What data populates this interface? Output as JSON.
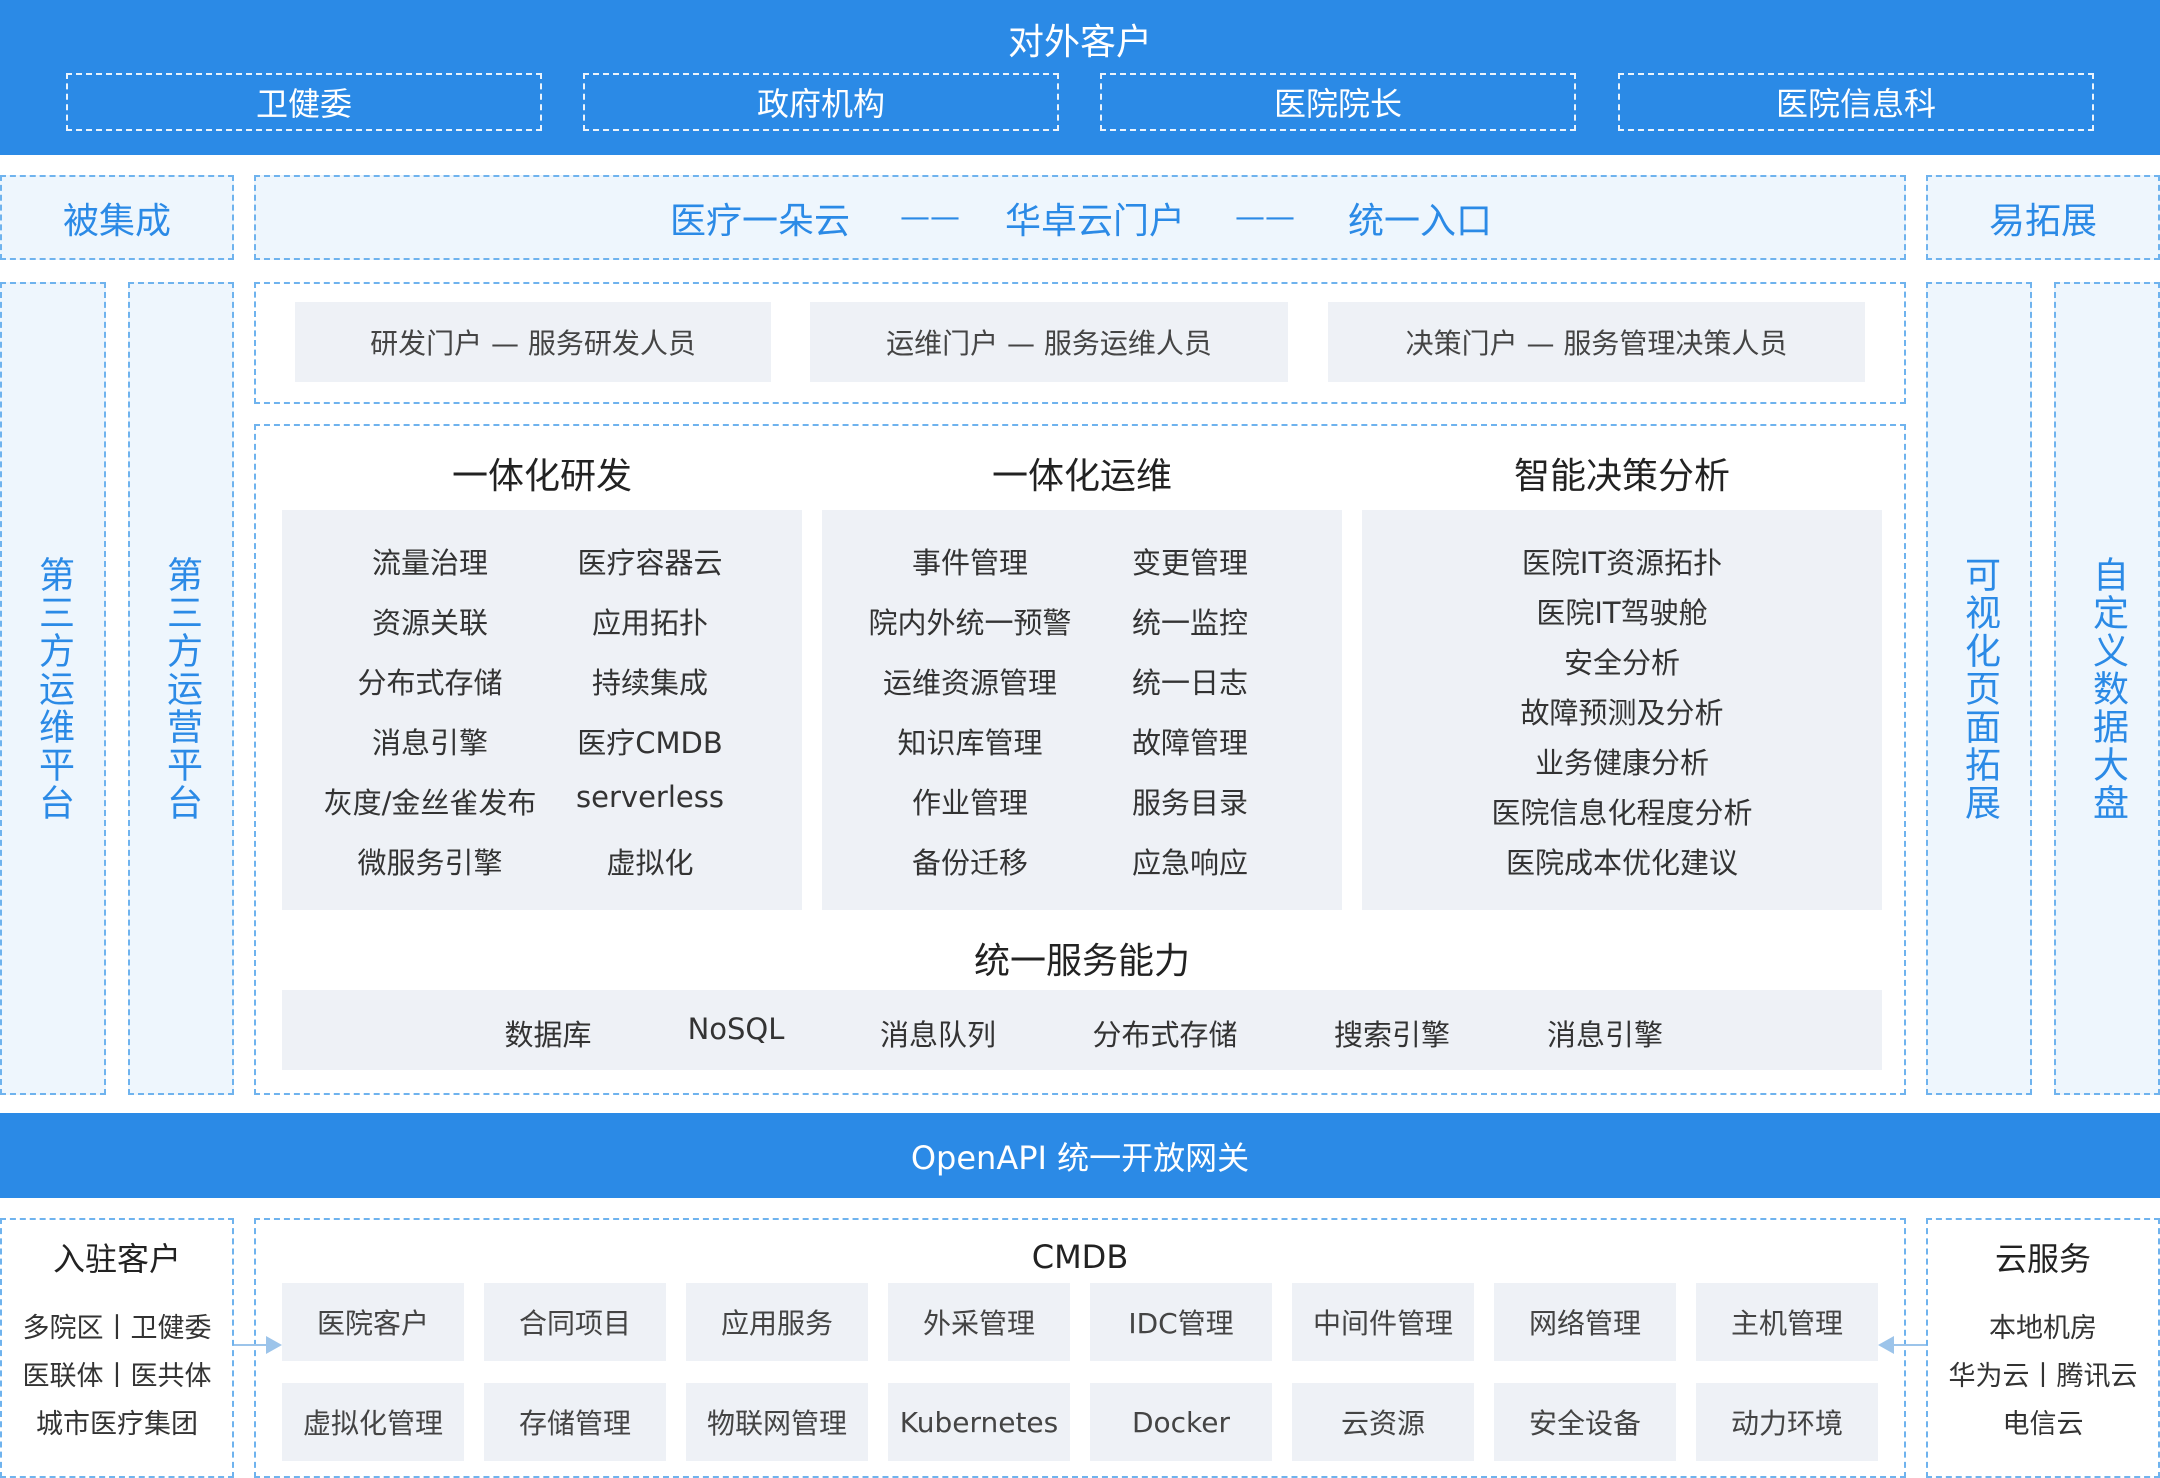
{
  "top": {
    "title": "对外客户",
    "customers": [
      "卫健委",
      "政府机构",
      "医院院长",
      "医院信息科"
    ]
  },
  "banner": {
    "left": "被集成",
    "center": [
      "医疗一朵云",
      "——",
      "华卓云门户",
      "——",
      "统一入口"
    ],
    "right": "易拓展"
  },
  "side_left": [
    "第三方运维平台",
    "第三方运营平台"
  ],
  "side_right": [
    "可视化页面拓展",
    "自定义数据大盘"
  ],
  "portals": [
    "研发门户 — 服务研发人员",
    "运维门户 — 服务运维人员",
    "决策门户 — 服务管理决策人员"
  ],
  "sections": [
    {
      "title": "一体化研发",
      "col1": [
        "流量治理",
        "资源关联",
        "分布式存储",
        "消息引擎",
        "灰度/金丝雀发布",
        "微服务引擎"
      ],
      "col2": [
        "医疗容器云",
        "应用拓扑",
        "持续集成",
        "医疗CMDB",
        "serverless",
        "虚拟化"
      ]
    },
    {
      "title": "一体化运维",
      "col1": [
        "事件管理",
        "院内外统一预警",
        "运维资源管理",
        "知识库管理",
        "作业管理",
        "备份迁移"
      ],
      "col2": [
        "变更管理",
        "统一监控",
        "统一日志",
        "故障管理",
        "服务目录",
        "应急响应"
      ]
    },
    {
      "title": "智能决策分析",
      "list": [
        "医院IT资源拓扑",
        "医院IT驾驶舱",
        "安全分析",
        "故障预测及分析",
        "业务健康分析",
        "医院信息化程度分析",
        "医院成本优化建议"
      ]
    }
  ],
  "unified": {
    "title": "统一服务能力",
    "items": [
      "数据库",
      "NoSQL",
      "消息队列",
      "分布式存储",
      "搜索引擎",
      "消息引擎"
    ]
  },
  "gateway": "OpenAPI 统一开放网关",
  "bottom": {
    "left": {
      "title": "入驻客户",
      "lines": [
        "多院区丨卫健委",
        "医联体丨医共体",
        "城市医疗集团"
      ]
    },
    "cmdb": {
      "title": "CMDB",
      "row1": [
        "医院客户",
        "合同项目",
        "应用服务",
        "外采管理",
        "IDC管理",
        "中间件管理",
        "网络管理",
        "主机管理"
      ],
      "row2": [
        "虚拟化管理",
        "存储管理",
        "物联网管理",
        "Kubernetes",
        "Docker",
        "云资源",
        "安全设备",
        "动力环境"
      ]
    },
    "right": {
      "title": "云服务",
      "lines": [
        "本地机房",
        "华为云丨腾讯云",
        "电信云"
      ]
    }
  },
  "colors": {
    "primary": "#2b8ae6",
    "light_bg": "#eef6fd",
    "panel_bg": "#eef1f6",
    "dash": "#6fb3ee"
  }
}
